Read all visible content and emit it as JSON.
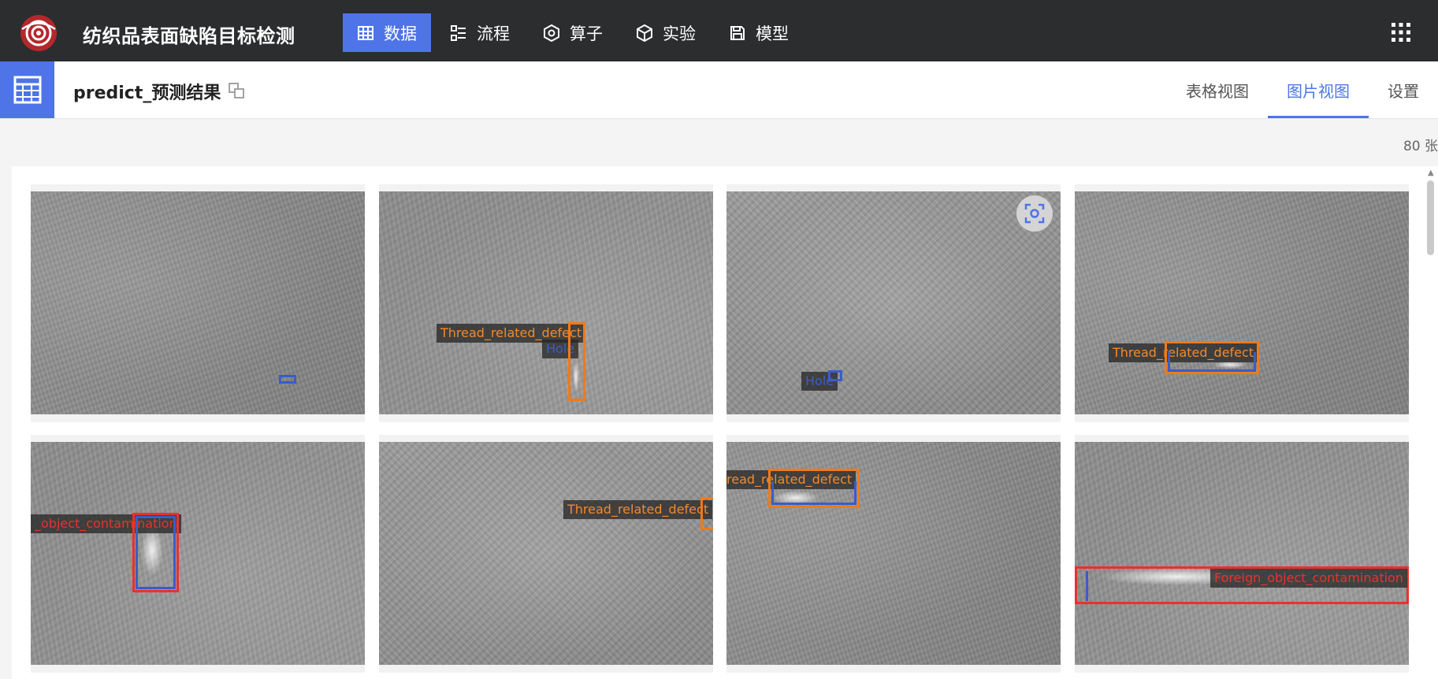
{
  "app": {
    "title": "纺织品表面缺陷目标检测"
  },
  "nav": {
    "items": [
      {
        "label": "数据",
        "icon": "table-icon",
        "active": true
      },
      {
        "label": "流程",
        "icon": "flow-icon",
        "active": false
      },
      {
        "label": "算子",
        "icon": "hexagon-icon",
        "active": false
      },
      {
        "label": "实验",
        "icon": "cube-icon",
        "active": false
      },
      {
        "label": "模型",
        "icon": "save-icon",
        "active": false
      }
    ]
  },
  "header": {
    "title": "predict_预测结果",
    "tabs": [
      {
        "label": "表格视图",
        "active": false
      },
      {
        "label": "图片视图",
        "active": true
      },
      {
        "label": "设置",
        "active": false
      }
    ]
  },
  "count_label": "80 张",
  "colors": {
    "accent": "#4e74e8",
    "topbar": "#2b2d2e",
    "thread_defect": "#f07a1a",
    "contamination": "#e8322d",
    "hole": "#3b5cc8"
  },
  "images": [
    {
      "labels": []
    },
    {
      "labels": [
        {
          "text": "Thread_related_defect",
          "color": "orange"
        },
        {
          "text": "Hole",
          "color": "blue"
        }
      ]
    },
    {
      "labels": [
        {
          "text": "Hole",
          "color": "blue"
        }
      ]
    },
    {
      "labels": [
        {
          "text": "Thread_related_defect",
          "color": "orange"
        }
      ]
    },
    {
      "labels": [
        {
          "text": "_object_contamination",
          "color": "red"
        }
      ]
    },
    {
      "labels": [
        {
          "text": "Thread_related_defect",
          "color": "orange"
        }
      ]
    },
    {
      "labels": [
        {
          "text": "read_related_defect",
          "color": "orange"
        }
      ]
    },
    {
      "labels": [
        {
          "text": "Foreign_object_contamination",
          "color": "red"
        }
      ]
    }
  ]
}
